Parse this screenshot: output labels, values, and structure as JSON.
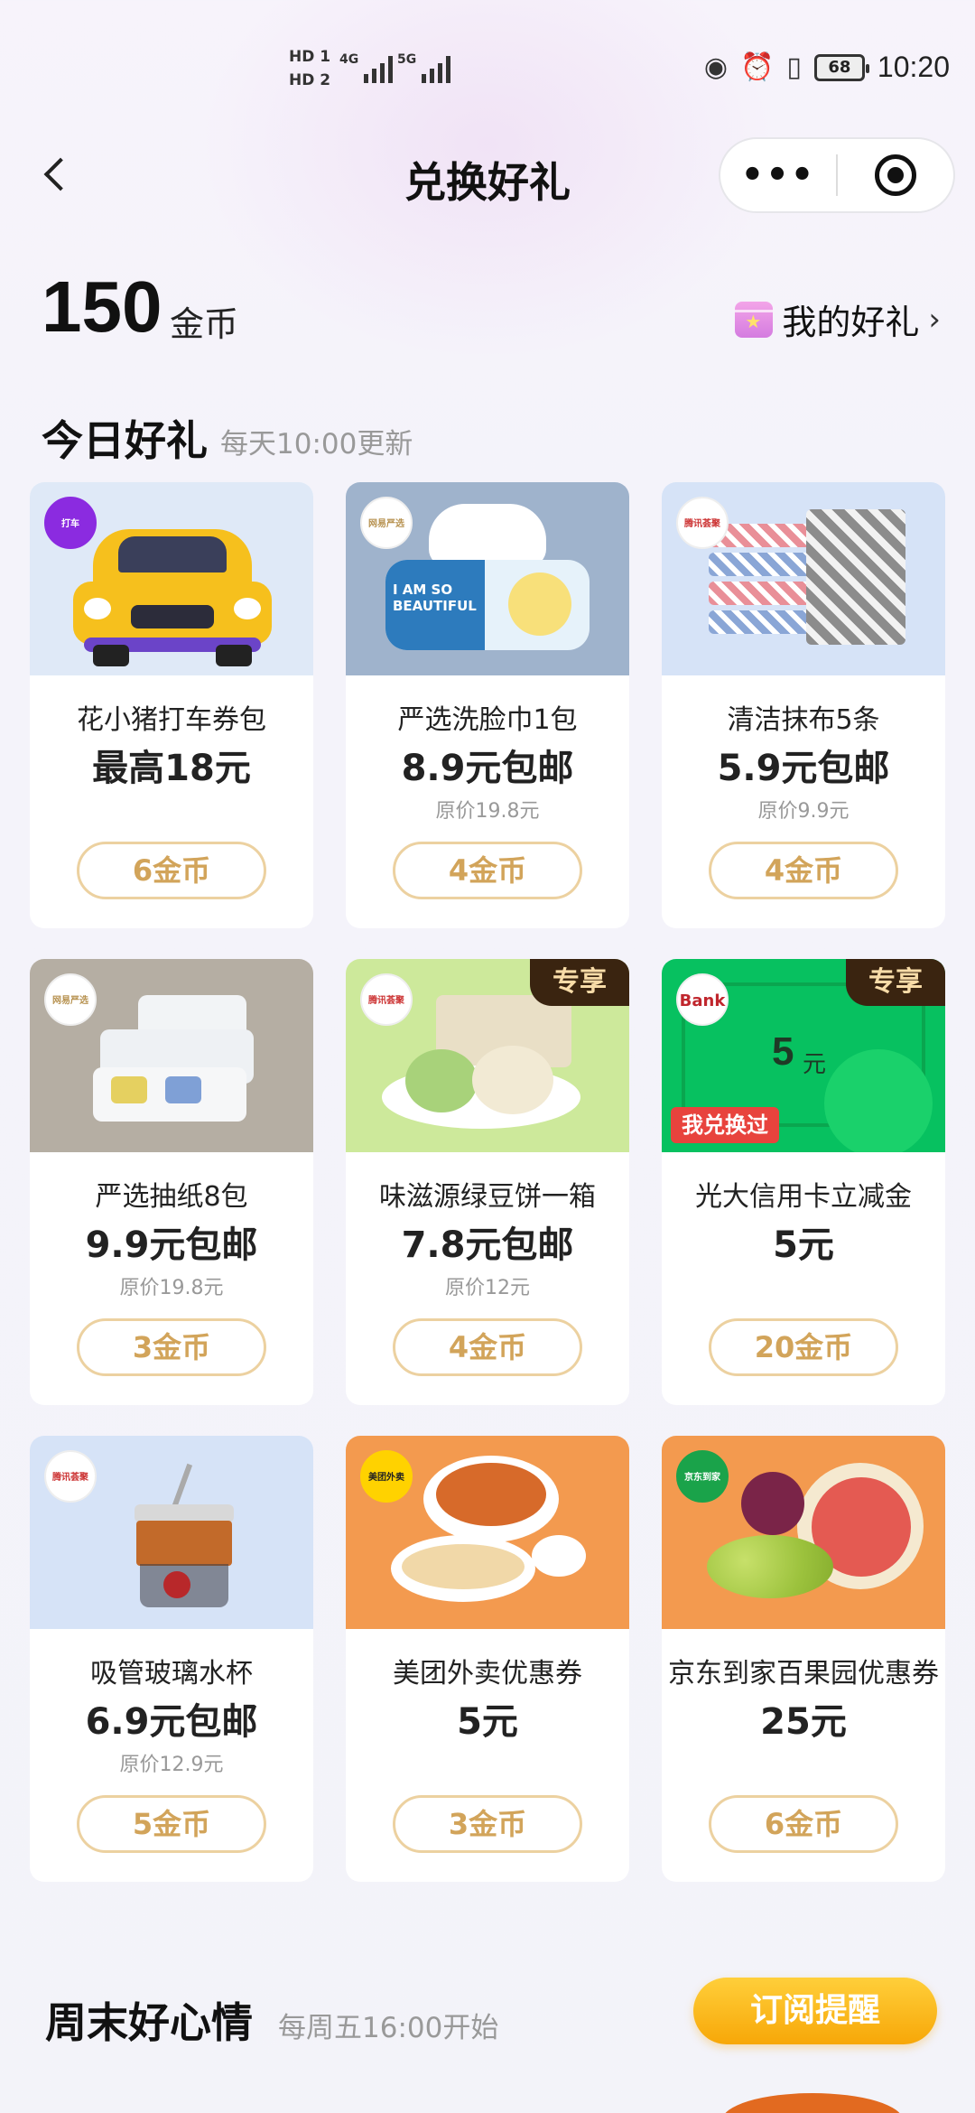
{
  "status_bar": {
    "hd1": "HD 1",
    "hd2": "HD 2",
    "net1": "4G",
    "net2": "5G",
    "battery": "68",
    "time": "10:20"
  },
  "nav": {
    "title": "兑换好礼",
    "more_icon": "•••"
  },
  "coins": {
    "amount": "150",
    "unit": "金币"
  },
  "my_gifts": {
    "label": "我的好礼",
    "chevron": "›"
  },
  "today": {
    "title": "今日好礼",
    "subtitle": "每天10:00更新"
  },
  "cards": [
    {
      "name": "花小猪打车券包",
      "price": "最高18元",
      "orig": "",
      "cost": "6金币",
      "logo": "打车",
      "exclusive": ""
    },
    {
      "name": "严选洗脸巾1包",
      "price": "8.9元包邮",
      "orig": "原价19.8元",
      "cost": "4金币",
      "logo": "网易严选",
      "exclusive": "",
      "img_text": "I AM SO BEAUTIFUL"
    },
    {
      "name": "清洁抹布5条",
      "price": "5.9元包邮",
      "orig": "原价9.9元",
      "cost": "4金币",
      "logo": "腾讯荟聚",
      "exclusive": ""
    },
    {
      "name": "严选抽纸8包",
      "price": "9.9元包邮",
      "orig": "原价19.8元",
      "cost": "3金币",
      "logo": "网易严选",
      "exclusive": ""
    },
    {
      "name": "味滋源绿豆饼一箱",
      "price": "7.8元包邮",
      "orig": "原价12元",
      "cost": "4金币",
      "logo": "腾讯荟聚",
      "exclusive": "专享"
    },
    {
      "name": "光大信用卡立减金",
      "price": "5元",
      "orig": "",
      "cost": "20金币",
      "logo": "Bank",
      "exclusive": "专享",
      "redeemed": "我兑换过",
      "img_value": "5",
      "img_unit": "元"
    },
    {
      "name": "吸管玻璃水杯",
      "price": "6.9元包邮",
      "orig": "原价12.9元",
      "cost": "5金币",
      "logo": "腾讯荟聚",
      "exclusive": ""
    },
    {
      "name": "美团外卖优惠券",
      "price": "5元",
      "orig": "",
      "cost": "3金币",
      "logo": "美团外卖",
      "exclusive": ""
    },
    {
      "name": "京东到家百果园优惠券",
      "price": "25元",
      "orig": "",
      "cost": "6金币",
      "logo": "京东到家",
      "exclusive": ""
    }
  ],
  "weekend": {
    "title": "周末好心情",
    "subtitle": "每周五16:00开始",
    "button": "订阅提醒"
  },
  "colors": {
    "accent_gold": "#d2a45a",
    "button_border": "#ecd1a0",
    "subscribe_yellow": "#f7a708",
    "exclusive_bg": "#3a2410"
  }
}
